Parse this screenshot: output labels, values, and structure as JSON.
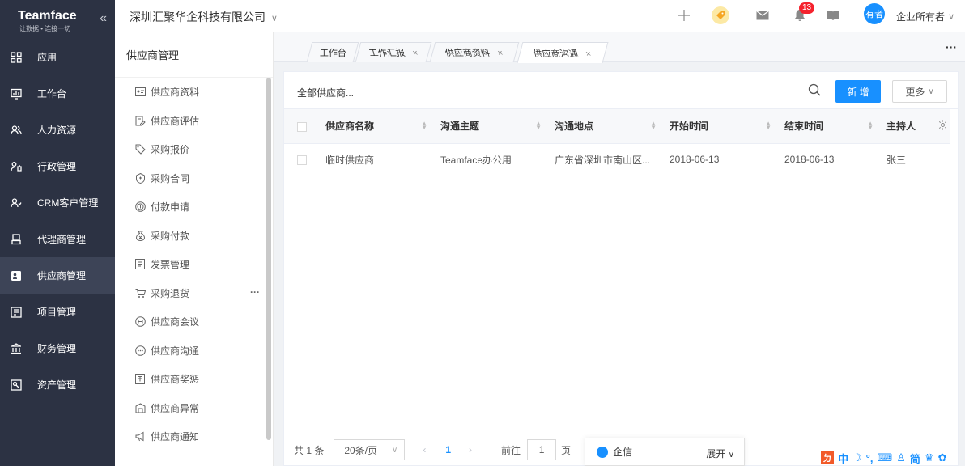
{
  "brand": {
    "name": "Teamface",
    "slogan": "让数据 • 连接一切"
  },
  "sidebar": {
    "items": [
      {
        "label": "应用"
      },
      {
        "label": "工作台"
      },
      {
        "label": "人力资源"
      },
      {
        "label": "行政管理"
      },
      {
        "label": "CRM客户管理"
      },
      {
        "label": "代理商管理"
      },
      {
        "label": "供应商管理"
      },
      {
        "label": "项目管理"
      },
      {
        "label": "财务管理"
      },
      {
        "label": "资产管理"
      }
    ]
  },
  "topbar": {
    "company": "深圳汇聚华企科技有限公司",
    "notification_count": "13",
    "avatar_text": "有者",
    "user_role": "企业所有者"
  },
  "submenu": {
    "title": "供应商管理",
    "items": [
      {
        "label": "供应商资料"
      },
      {
        "label": "供应商评估"
      },
      {
        "label": "采购报价"
      },
      {
        "label": "采购合同"
      },
      {
        "label": "付款申请"
      },
      {
        "label": "采购付款"
      },
      {
        "label": "发票管理"
      },
      {
        "label": "采购退货"
      },
      {
        "label": "供应商会议"
      },
      {
        "label": "供应商沟通"
      },
      {
        "label": "供应商奖惩"
      },
      {
        "label": "供应商异常"
      },
      {
        "label": "供应商通知"
      }
    ]
  },
  "tabs": [
    {
      "label": "工作台"
    },
    {
      "label": "工作汇报"
    },
    {
      "label": "供应商资料"
    },
    {
      "label": "供应商沟通"
    }
  ],
  "toolbar": {
    "filter": "全部供应商...",
    "new_label": "新 增",
    "more_label": "更多"
  },
  "table": {
    "columns": [
      "供应商名称",
      "沟通主题",
      "沟通地点",
      "开始时间",
      "结束时间",
      "主持人"
    ],
    "rows": [
      [
        "临时供应商",
        "Teamface办公用",
        "广东省深圳市南山区...",
        "2018-06-13",
        "2018-06-13",
        "张三"
      ]
    ]
  },
  "pager": {
    "total": "共 1 条",
    "page_size": "20条/页",
    "current": "1",
    "goto_label": "前往",
    "goto_value": "1",
    "page_unit": "页"
  },
  "chat": {
    "label": "企信",
    "expand": "展开"
  },
  "ime": {
    "logo": "ㄉ",
    "mode": "中",
    "simp": "简"
  },
  "colors": {
    "sidebar_bg": "#2c3243",
    "accent": "#1890ff",
    "badge": "#f5222d"
  }
}
